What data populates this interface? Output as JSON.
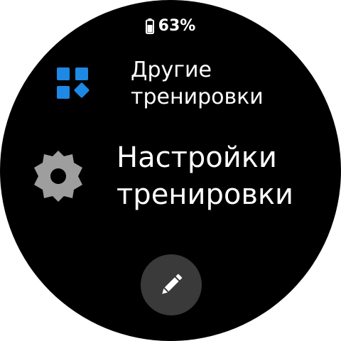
{
  "status": {
    "battery_icon": "battery-icon",
    "battery_percent": "63%"
  },
  "menu": {
    "items": [
      {
        "label": "Другие\nтренировки",
        "icon": "grid-shapes-icon",
        "icon_color": "#1e88e5"
      },
      {
        "label": "Настройки\nтренировки",
        "icon": "gear-icon",
        "icon_color": "#9e9e9e"
      }
    ]
  },
  "edit_button": {
    "icon": "pencil-icon",
    "background": "#3a3a3a"
  }
}
